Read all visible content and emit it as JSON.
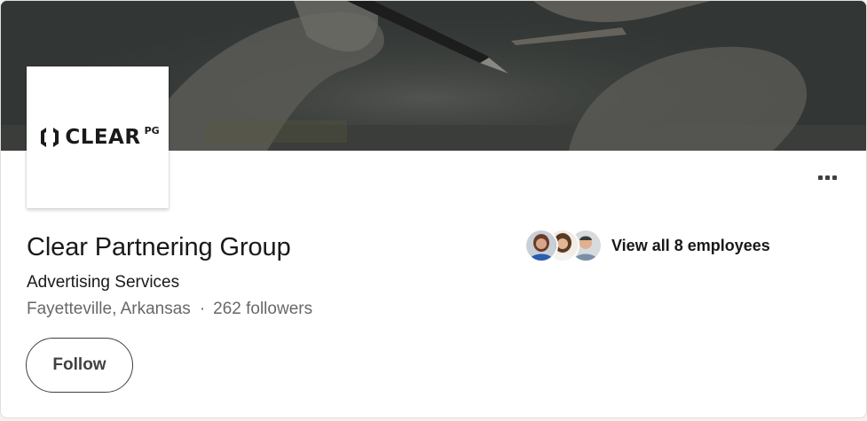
{
  "company": {
    "logo_text": "CLEAR",
    "logo_superscript": "PG",
    "name": "Clear Partnering Group",
    "industry": "Advertising Services",
    "location": "Fayetteville, Arkansas",
    "separator": "·",
    "followers": "262 followers"
  },
  "actions": {
    "follow_label": "Follow",
    "more_icon": "ellipsis-icon"
  },
  "employees": {
    "link_label": "View all 8 employees",
    "avatar_count": 3
  },
  "colors": {
    "cover_bg": "#2f3331",
    "card_bg": "#ffffff",
    "button_border": "#404040"
  }
}
